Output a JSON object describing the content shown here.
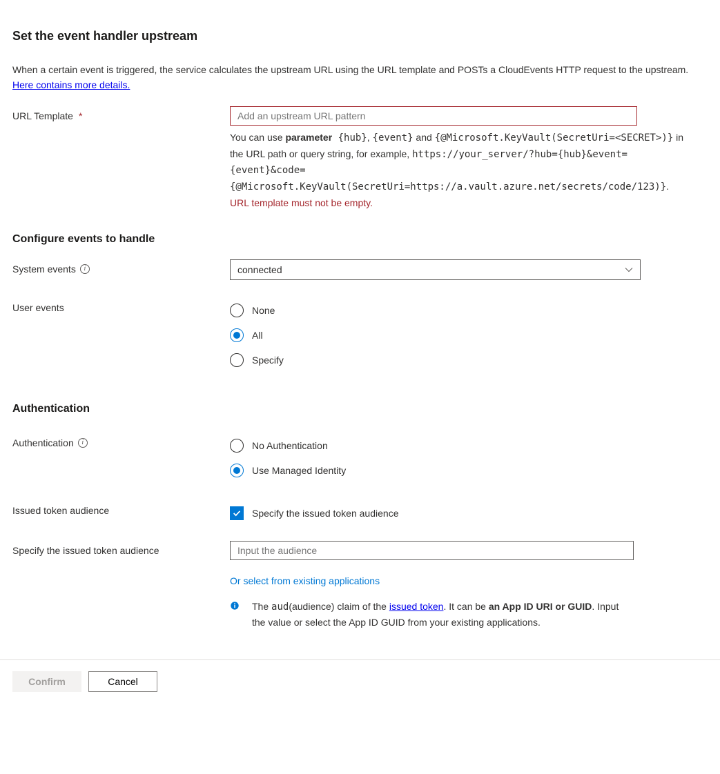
{
  "title": "Set the event handler upstream",
  "intro": {
    "text_a": "When a certain event is triggered, the service calculates the upstream URL using the URL template and POSTs a CloudEvents HTTP request to the upstream. ",
    "link": "Here contains more details."
  },
  "url_template": {
    "label": "URL Template",
    "required": "*",
    "placeholder": "Add an upstream URL pattern",
    "value": "",
    "help_a": "You can use ",
    "help_b_strong": "parameter",
    "help_c_mono": " {hub}",
    "help_d": ", ",
    "help_e_mono": "{event}",
    "help_f": " and ",
    "help_g_mono": "{@Microsoft.KeyVault(SecretUri=<SECRET>)}",
    "help_h": " in the URL path or query string, for example, ",
    "help_i_mono": "https://your_server/?hub={hub}&event={event}&code={@Microsoft.KeyVault(SecretUri=https://a.vault.azure.net/secrets/code/123)}",
    "help_j": ".",
    "error": "URL template must not be empty."
  },
  "events": {
    "section": "Configure events to handle",
    "system_label": "System events",
    "system_value": "connected",
    "user_label": "User events",
    "user_options": {
      "none": "None",
      "all": "All",
      "specify": "Specify"
    },
    "user_selected": "all"
  },
  "auth": {
    "section": "Authentication",
    "label": "Authentication",
    "options": {
      "none": "No Authentication",
      "managed": "Use Managed Identity"
    },
    "selected": "managed",
    "issued_label": "Issued token audience",
    "issued_check_label": "Specify the issued token audience",
    "issued_checked": true,
    "specify_label": "Specify the issued token audience",
    "specify_placeholder": "Input the audience",
    "specify_value": "",
    "select_existing": "Or select from existing applications",
    "info_a": "The ",
    "info_b_mono": "aud",
    "info_c": "(audience) claim of the ",
    "info_link": "issued token",
    "info_d": ". It can be ",
    "info_e_strong": "an App ID URI or GUID",
    "info_f": ". Input the value or select the App ID GUID from your existing applications."
  },
  "footer": {
    "confirm": "Confirm",
    "cancel": "Cancel"
  }
}
